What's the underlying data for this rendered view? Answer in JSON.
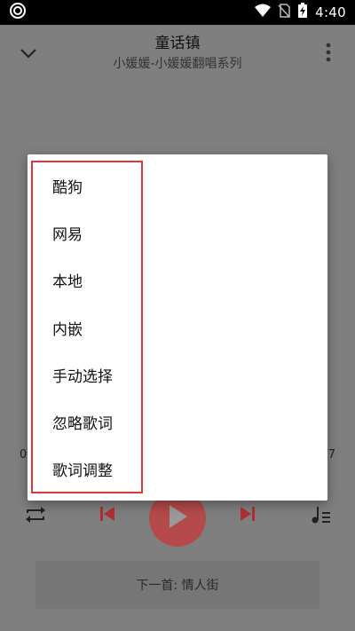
{
  "status_bar": {
    "time": "4:40",
    "icons": [
      "app-status-icon",
      "wifi-icon",
      "no-sim-icon",
      "battery-charging-icon"
    ]
  },
  "header": {
    "title": "童话镇",
    "subtitle": "小媛媛-小媛媛翻唱系列"
  },
  "player": {
    "time_elapsed_partial": "0",
    "time_total_partial": "7"
  },
  "next_track": {
    "label": "下一首: 情人街"
  },
  "lyrics_source_menu": {
    "items": [
      {
        "label": "酷狗"
      },
      {
        "label": "网易"
      },
      {
        "label": "本地"
      },
      {
        "label": "内嵌"
      },
      {
        "label": "手动选择"
      },
      {
        "label": "忽略歌词"
      },
      {
        "label": "歌词调整"
      }
    ]
  },
  "colors": {
    "overlay_background": "#7f7f7f",
    "accent_red": "#c04040",
    "highlight_border": "#e0353a"
  }
}
